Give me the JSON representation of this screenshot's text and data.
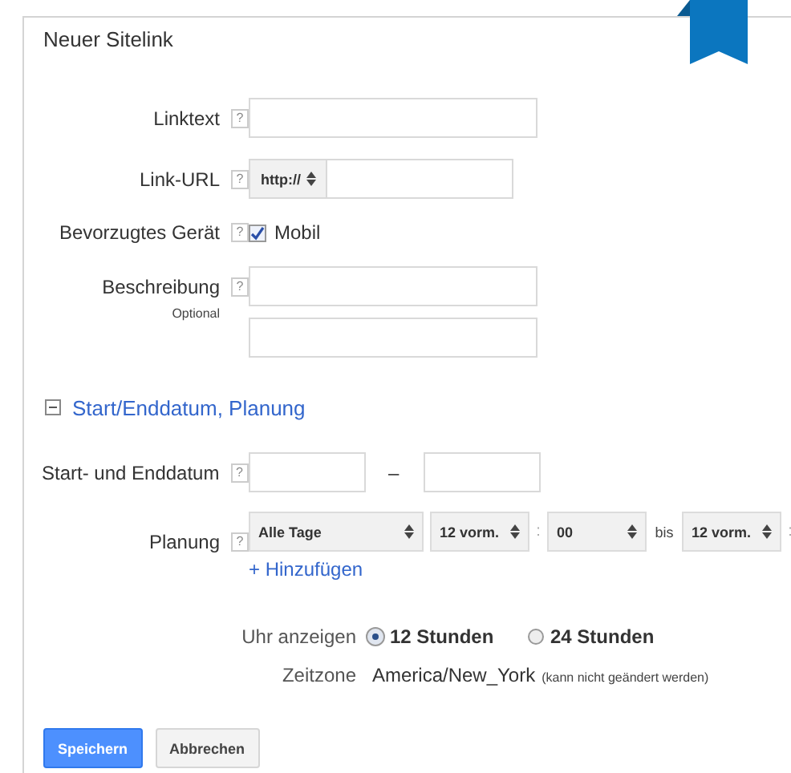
{
  "title": "Neuer Sitelink",
  "fields": [
    {
      "kind": "text",
      "label": "Linktext",
      "help": "?"
    },
    {
      "kind": "url",
      "label": "Link-URL",
      "help": "?",
      "protocol": "http://"
    },
    {
      "kind": "checkbox",
      "label": "Bevorzugtes Gerät",
      "help": "?",
      "option": "Mobil",
      "checked": true
    },
    {
      "kind": "description",
      "label": "Beschreibung",
      "help": "?",
      "note": "Optional"
    }
  ],
  "section": {
    "label": "Start/Enddatum, Planung",
    "expanded": true
  },
  "dates": {
    "label": "Start- und Enddatum",
    "help": "?",
    "separator": "–"
  },
  "schedule": {
    "label": "Planung",
    "help": "?",
    "controls": [
      {
        "kind": "day-select",
        "value": "Alle Tage"
      },
      {
        "kind": "time-select",
        "value": "12 vorm."
      },
      {
        "kind": "text",
        "value": ":"
      },
      {
        "kind": "time-select",
        "value": "00"
      },
      {
        "kind": "text",
        "value": "bis"
      },
      {
        "kind": "time-select",
        "value": "12 vorm."
      },
      {
        "kind": "text",
        "value": ":"
      }
    ],
    "add_link": "+ Hinzufügen"
  },
  "clock": {
    "label": "Uhr anzeigen",
    "options": [
      {
        "label": "12 Stunden",
        "selected": true
      },
      {
        "label": "24 Stunden",
        "selected": false
      }
    ]
  },
  "timezone": {
    "label": "Zeitzone",
    "value": "America/New_York",
    "note": "(kann nicht geändert werden)"
  },
  "buttons": [
    {
      "label": "Speichern",
      "kind": "primary"
    },
    {
      "label": "Abbrechen",
      "kind": "secondary"
    }
  ]
}
